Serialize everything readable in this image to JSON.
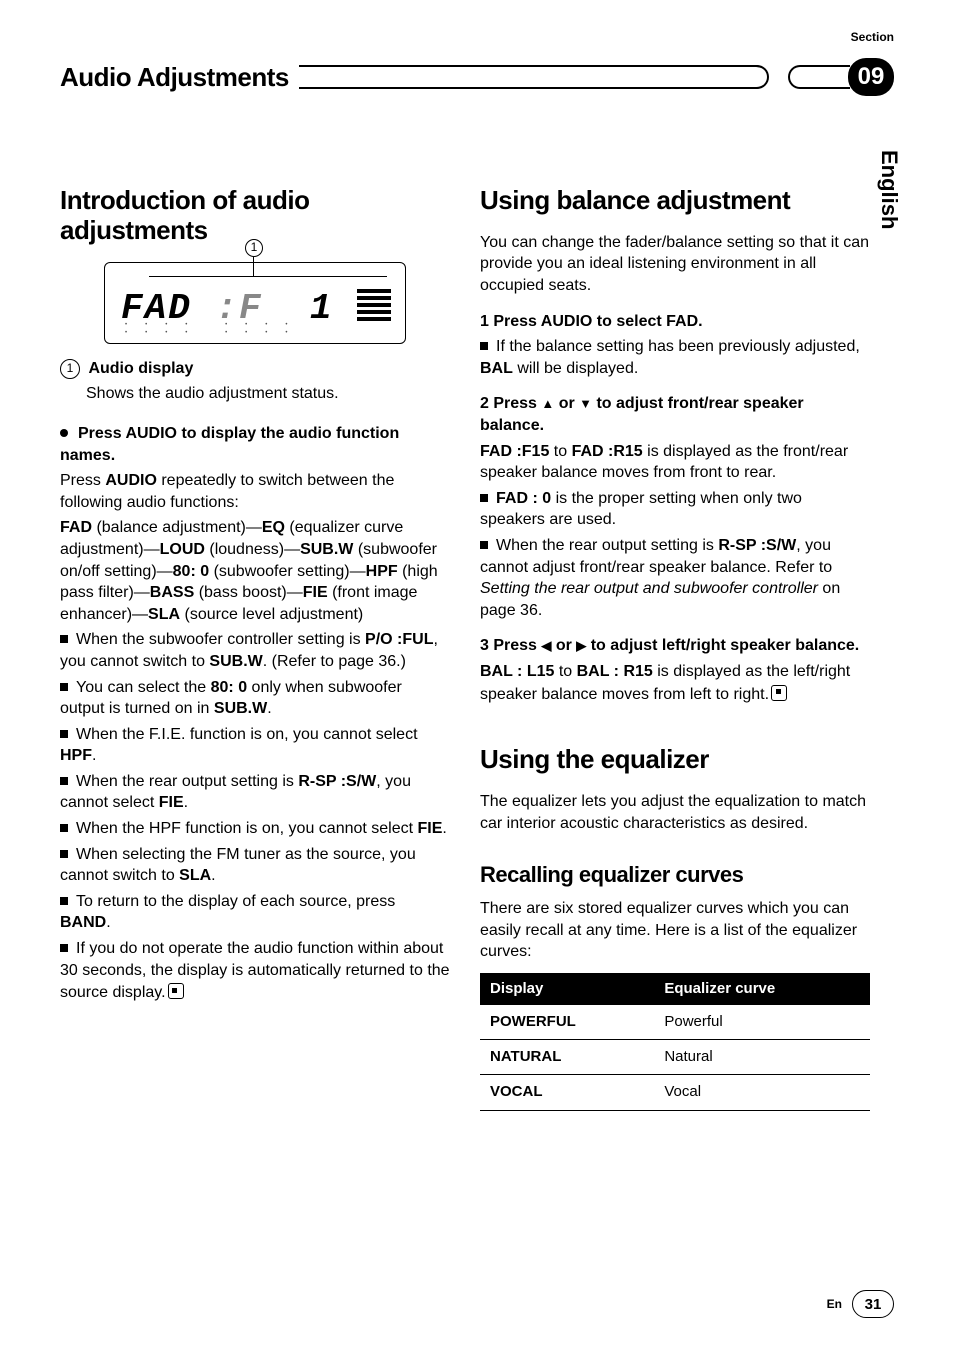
{
  "header": {
    "section_label": "Section",
    "title": "Audio Adjustments",
    "section_number": "09",
    "language_tab": "English"
  },
  "left": {
    "h1": "Introduction of audio adjustments",
    "callout_num": "1",
    "item1_num": "1",
    "item1_label": "Audio display",
    "item1_desc": "Shows the audio adjustment status.",
    "lead_bold": "Press AUDIO to display the audio function names.",
    "p1a": "Press ",
    "audio_b": "AUDIO",
    "p1b": " repeatedly to switch between the following audio functions:",
    "fad": "FAD",
    "fad_t": " (balance adjustment)—",
    "eq": "EQ",
    "eq_t": " (equalizer curve adjustment)—",
    "loud": "LOUD",
    "loud_t": " (loudness)—",
    "subw": "SUB.W",
    "subw_t": " (subwoofer on/off setting)—",
    "eighty": "80: 0",
    "eighty_t": " (subwoofer setting)—",
    "hpf": "HPF",
    "hpf_t": " (high pass filter)—",
    "bass": "BASS",
    "bass_t": " (bass boost)—",
    "fie": "FIE",
    "fie_t": " (front image enhancer)—",
    "sla": "SLA",
    "sla_t": " (source level adjustment)",
    "n1a": "When the subwoofer controller setting is ",
    "poful": "P/O :FUL",
    "n1b": ", you cannot switch to ",
    "n1_subw": "SUB.W",
    "n1c": ". (Refer to page 36.)",
    "n2a": "You can select the ",
    "n2_80": "80: 0",
    "n2b": " only when subwoofer output is turned on in ",
    "n2_subw": "SUB.W",
    "n2c": ".",
    "n3a": "When the F.I.E. function is on, you cannot select ",
    "n3_hpf": "HPF",
    "n3b": ".",
    "n4a": "When the rear output setting is ",
    "n4_rsp": "R-SP :S/W",
    "n4b": ", you cannot select ",
    "n4_fie": "FIE",
    "n4c": ".",
    "n5a": "When the HPF function is on, you cannot select ",
    "n5_fie": "FIE",
    "n5b": ".",
    "n6a": "When selecting the FM tuner as the source, you cannot switch to ",
    "n6_sla": "SLA",
    "n6b": ".",
    "n7a": "To return to the display of each source, press ",
    "n7_band": "BAND",
    "n7b": ".",
    "n8": "If you do not operate the audio function within about 30 seconds, the display is automatically returned to the source display."
  },
  "right": {
    "h1": "Using balance adjustment",
    "intro": "You can change the fader/balance setting so that it can provide you an ideal listening environment in all occupied seats.",
    "s1": "1    Press AUDIO to select FAD.",
    "s1n_a": "If the balance setting has been previously adjusted, ",
    "s1n_bal": "BAL",
    "s1n_b": " will be displayed.",
    "s2a": "2    Press ",
    "s2up": "▲",
    "s2mid": " or ",
    "s2dn": "▼",
    "s2b": " to adjust front/rear speaker balance.",
    "s2p_a": "FAD :F15",
    "s2p_mid": " to ",
    "s2p_b": "FAD :R15",
    "s2p_c": " is displayed as the front/rear speaker balance moves from front to rear.",
    "s2n1_b": "FAD : 0",
    "s2n1_t": " is the proper setting when only two speakers are used.",
    "s2n2_a": "When the rear output setting is ",
    "s2n2_rsp": "R-SP :S/W",
    "s2n2_b": ", you cannot adjust front/rear speaker balance. Refer to ",
    "s2n2_it": "Setting the rear output and subwoofer controller",
    "s2n2_c": " on page 36.",
    "s3a": "3    Press ",
    "s3l": "◀",
    "s3mid": " or ",
    "s3r": "▶",
    "s3b": " to adjust left/right speaker balance.",
    "s3p_a": "BAL : L15",
    "s3p_mid": " to ",
    "s3p_b": "BAL : R15",
    "s3p_c": " is displayed as the left/right speaker balance moves from left to right.",
    "h2": "Using the equalizer",
    "eq_intro": "The equalizer lets you adjust the equalization to match car interior acoustic characteristics as desired.",
    "h3": "Recalling equalizer curves",
    "eq_p": "There are six stored equalizer curves which you can easily recall at any time. Here is a list of the equalizer curves:",
    "th1": "Display",
    "th2": "Equalizer curve",
    "r1a": "POWERFUL",
    "r1b": "Powerful",
    "r2a": "NATURAL",
    "r2b": "Natural",
    "r3a": "VOCAL",
    "r3b": "Vocal"
  },
  "footer": {
    "lang": "En",
    "page": "31"
  }
}
